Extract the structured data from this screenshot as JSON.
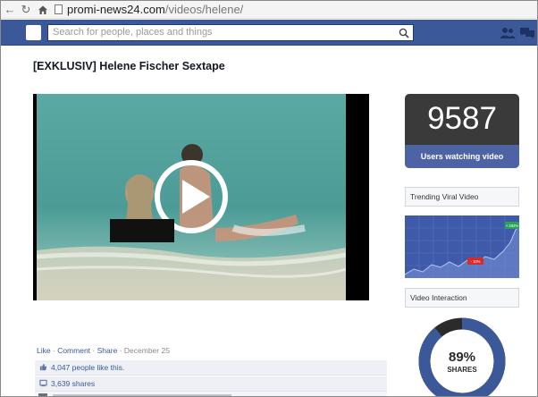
{
  "browser": {
    "url_domain": "promi-news24.com",
    "url_path": "/videos/helene/"
  },
  "fb_bar": {
    "search_placeholder": "Search for people, places and things"
  },
  "post": {
    "title": "[EXKLUSIV] Helene Fischer Sextape",
    "actions": {
      "like": "Like",
      "comment": "Comment",
      "share": "Share",
      "date": "December 25"
    },
    "likes": "4,047 people like this.",
    "shares": "3,639 shares"
  },
  "sidebar": {
    "viewer_count": "9587",
    "viewer_label": "Users watching video",
    "trending_label": "Trending Viral Video",
    "trend_up_badge": "+ 282%",
    "trend_down_badge": "- 10%",
    "interaction_label": "Video Interaction",
    "interaction_percent": "89%",
    "interaction_caption": "SHARES",
    "interaction_value": 0.89
  },
  "colors": {
    "fb_blue": "#3b5998",
    "counter_bg": "#3a3a3a",
    "donut_ring": "#3b5998",
    "donut_rest": "#2b2b2b",
    "trend_up": "#27a35a",
    "trend_down": "#d62b2b"
  }
}
